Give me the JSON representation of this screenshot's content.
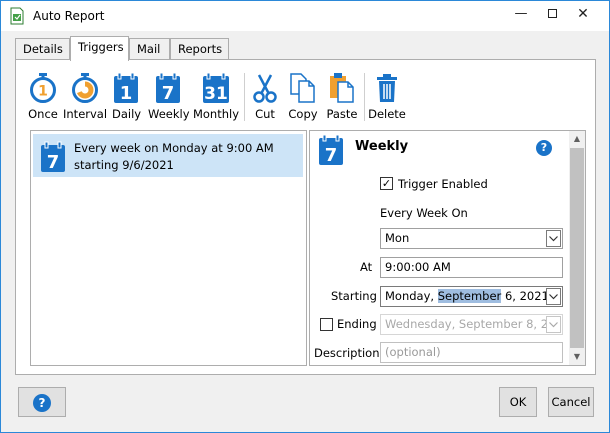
{
  "window": {
    "title": "Auto Report"
  },
  "tabs": [
    "Details",
    "Triggers",
    "Mail",
    "Reports"
  ],
  "toolbar": {
    "once": "Once",
    "interval": "Interval",
    "daily": "Daily",
    "weekly": "Weekly",
    "monthly": "Monthly",
    "cut": "Cut",
    "copy": "Copy",
    "paste": "Paste",
    "delete": "Delete",
    "daily_num": "1",
    "weekly_num": "7",
    "monthly_num": "31"
  },
  "triggers": [
    {
      "line1": "Every week on Monday at 9:00 AM",
      "line2": "starting 9/6/2021",
      "icon_num": "7"
    }
  ],
  "detail": {
    "title": "Weekly",
    "icon_num": "7",
    "help": "?",
    "trigger_enabled_label": "Trigger Enabled",
    "trigger_enabled": true,
    "every_week_on_label": "Every Week On",
    "day_value": "Mon",
    "at_label": "At",
    "at_value": "9:00:00 AM",
    "starting_label": "Starting",
    "starting_pre": "Monday, ",
    "starting_sel": "September",
    "starting_post": " 6, 2021",
    "ending_label": "Ending",
    "ending_enabled": false,
    "ending_value": "Wednesday, September 8, 20",
    "description_label": "Description",
    "description_placeholder": "(optional)"
  },
  "footer": {
    "help": "?",
    "ok": "OK",
    "cancel": "Cancel"
  },
  "colors": {
    "accent": "#1a73c8",
    "selection": "#cde4f7",
    "orange": "#f0a030"
  }
}
